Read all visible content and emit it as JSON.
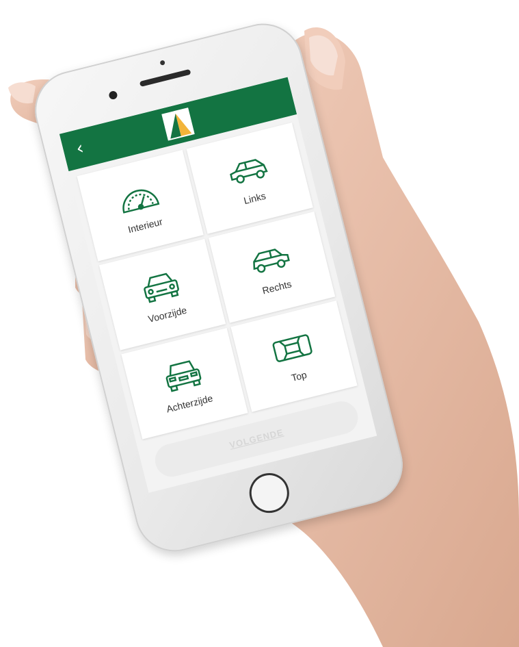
{
  "header": {
    "back_icon": "chevron-left-icon",
    "back_glyph": "‹",
    "logo_icon": "brand-logo-icon",
    "bg_color": "#137442"
  },
  "tiles": [
    {
      "label": "Interieur",
      "icon": "speedometer-icon"
    },
    {
      "label": "Links",
      "icon": "car-side-left-icon"
    },
    {
      "label": "Voorzijde",
      "icon": "car-front-icon"
    },
    {
      "label": "Rechts",
      "icon": "car-side-right-icon"
    },
    {
      "label": "Achterzijde",
      "icon": "car-rear-icon"
    },
    {
      "label": "Top",
      "icon": "car-top-icon"
    }
  ],
  "footer": {
    "next_label": "VOLGENDE",
    "disabled": true
  },
  "colors": {
    "accent": "#137442",
    "logo_accent": "#f2b43a",
    "icon_stroke": "#137442"
  }
}
